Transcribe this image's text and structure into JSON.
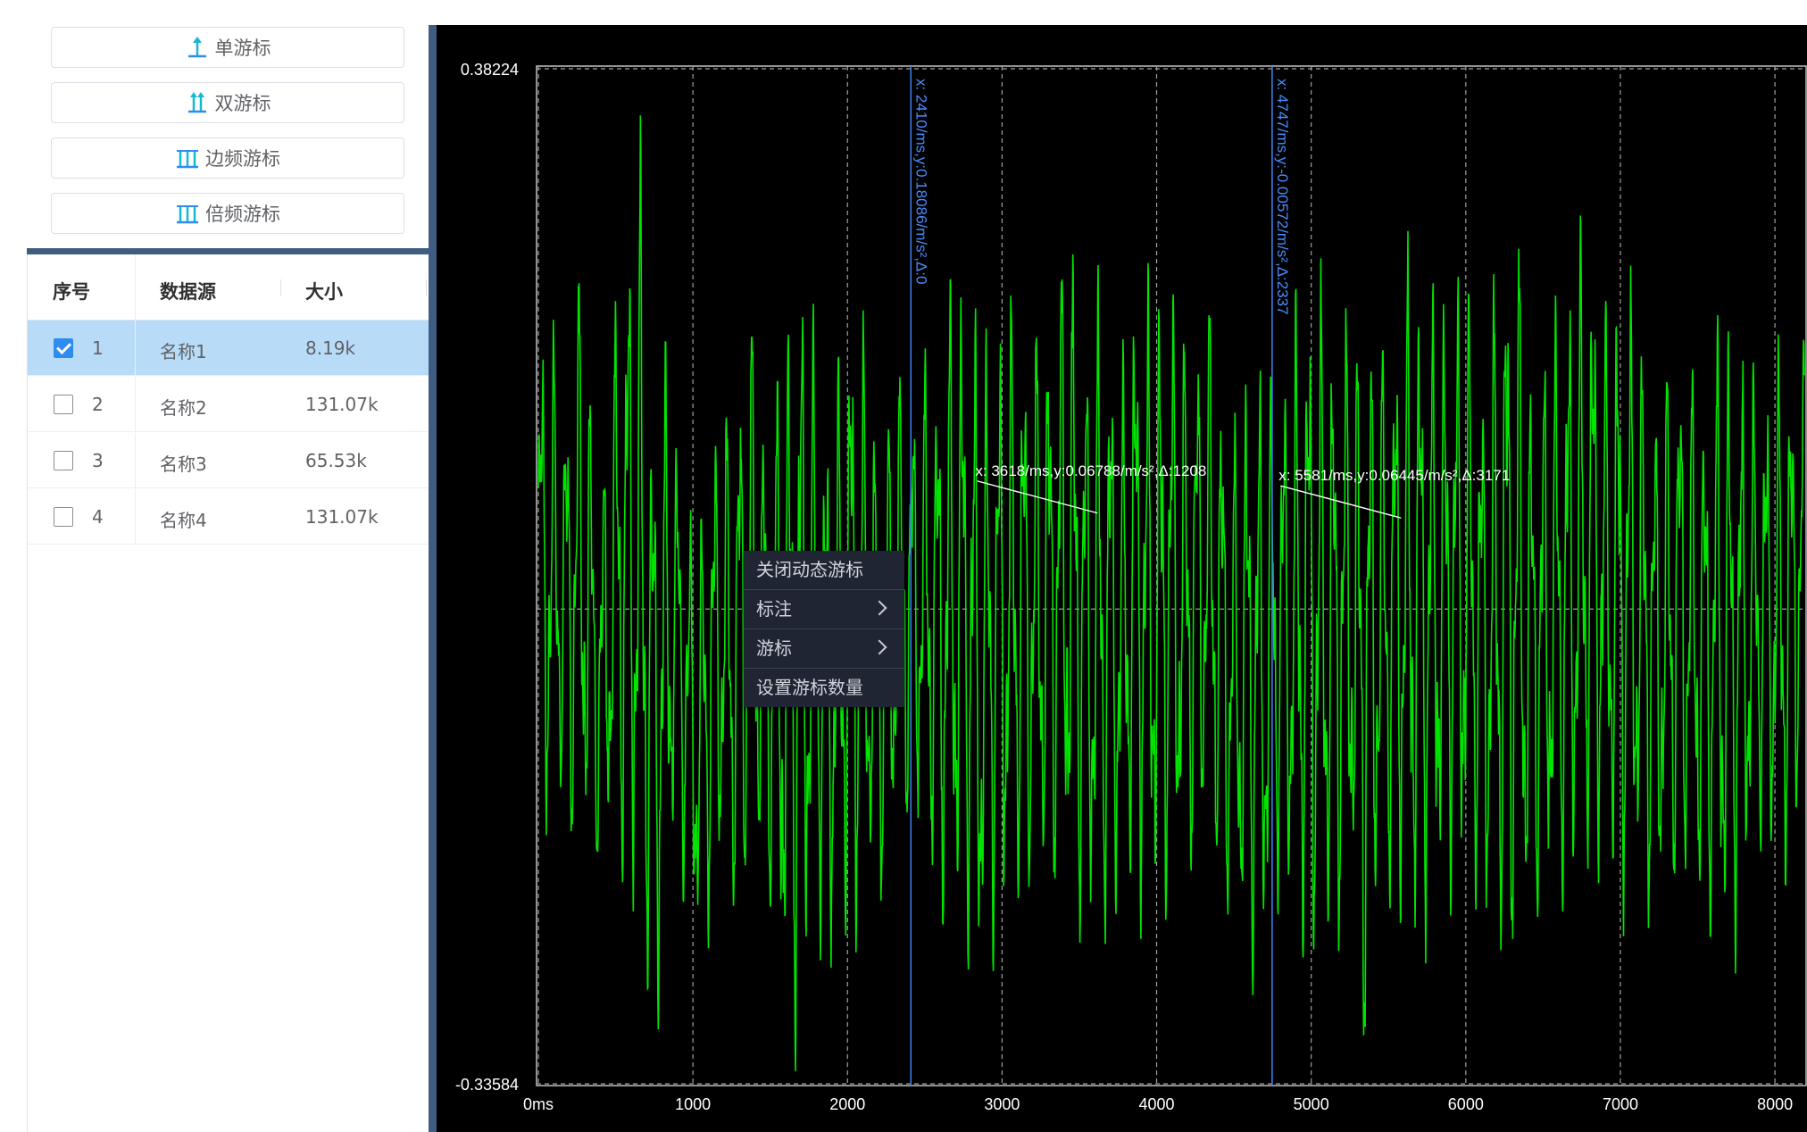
{
  "toolbar": {
    "single_cursor": "单游标",
    "double_cursor": "双游标",
    "sideband_cursor": "边频游标",
    "harmonic_cursor": "倍频游标"
  },
  "table": {
    "headers": [
      "序号",
      "数据源",
      "大小"
    ],
    "rows": [
      {
        "index": "1",
        "source": "名称1",
        "size": "8.19k",
        "checked": true
      },
      {
        "index": "2",
        "source": "名称2",
        "size": "131.07k",
        "checked": false
      },
      {
        "index": "3",
        "source": "名称3",
        "size": "65.53k",
        "checked": false
      },
      {
        "index": "4",
        "source": "名称4",
        "size": "131.07k",
        "checked": false
      }
    ]
  },
  "context_menu": {
    "items": [
      "关闭动态游标",
      "标注",
      "游标",
      "设置游标数量"
    ]
  },
  "colors": {
    "trace": "#00e400",
    "cursor": "#3b7de8",
    "selected_row": "#b8dcf8",
    "panel_bar": "#3e5d80"
  },
  "chart_data": {
    "type": "line",
    "xlim": [
      0,
      8190
    ],
    "ylim": [
      -0.33584,
      0.38224
    ],
    "y_tick_labels": [
      "0.38224",
      "-0.33584"
    ],
    "x_ticks": [
      0,
      1000,
      2000,
      3000,
      4000,
      5000,
      6000,
      7000,
      8000
    ],
    "x_tick_labels": [
      "0ms",
      "1000",
      "2000",
      "3000",
      "4000",
      "5000",
      "6000",
      "7000",
      "8000"
    ],
    "grid": true,
    "cursors": [
      {
        "x": 2410,
        "label": "x: 2410/ms,y:0.18086/m/s²,Δ:0"
      },
      {
        "x": 4747,
        "label": "x: 4747/ms,y:-0.00572/m/s²,Δ:2337"
      }
    ],
    "annotations": [
      {
        "x": 3618,
        "y": 0.06788,
        "label": "x: 3618/ms,y:0.06788/m/s²,Δ:1208"
      },
      {
        "x": 5581,
        "y": 0.06445,
        "label": "x: 5581/ms,y:0.06445/m/s²,Δ:3171"
      }
    ],
    "series": [
      {
        "signal": "vibration",
        "peaks": [
          [
            60,
            0.23
          ],
          [
            170,
            0.17
          ],
          [
            285,
            0.29
          ],
          [
            370,
            0.12
          ],
          [
            420,
            0.12
          ],
          [
            510,
            0.26
          ],
          [
            660,
            0.35
          ],
          [
            740,
            0.17
          ],
          [
            810,
            0.2
          ],
          [
            900,
            0.14
          ],
          [
            1020,
            0.06
          ],
          [
            1180,
            0.19
          ],
          [
            1250,
            0.14
          ],
          [
            1350,
            0.26
          ],
          [
            1480,
            0.14
          ],
          [
            1680,
            0.29
          ],
          [
            1800,
            0.2
          ],
          [
            1880,
            0.15
          ],
          [
            2050,
            0.27
          ],
          [
            2200,
            0.13
          ],
          [
            2300,
            0.2
          ],
          [
            2410,
            0.18
          ],
          [
            2580,
            0.2
          ],
          [
            2690,
            0.28
          ],
          [
            2800,
            0.24
          ],
          [
            2900,
            0.21
          ],
          [
            3060,
            0.24
          ],
          [
            3130,
            0.22
          ],
          [
            3300,
            0.23
          ],
          [
            3420,
            0.31
          ],
          [
            3580,
            0.2
          ],
          [
            3640,
            0.27
          ],
          [
            3760,
            0.17
          ],
          [
            3880,
            0.28
          ],
          [
            3960,
            0.24
          ],
          [
            4070,
            0.27
          ],
          [
            4200,
            0.22
          ],
          [
            4340,
            0.25
          ],
          [
            4480,
            0.14
          ],
          [
            4600,
            0.2
          ],
          [
            4750,
            0.19
          ],
          [
            4870,
            0.21
          ],
          [
            4990,
            0.28
          ],
          [
            5120,
            0.23
          ],
          [
            5230,
            0.24
          ],
          [
            5360,
            0.24
          ],
          [
            5490,
            0.21
          ],
          [
            5620,
            0.27
          ],
          [
            5720,
            0.26
          ],
          [
            5860,
            0.24
          ],
          [
            5990,
            0.27
          ],
          [
            6100,
            0.2
          ],
          [
            6250,
            0.29
          ],
          [
            6300,
            0.35
          ],
          [
            6420,
            0.19
          ],
          [
            6600,
            0.24
          ],
          [
            6800,
            0.3
          ],
          [
            6900,
            0.23
          ],
          [
            7050,
            0.26
          ],
          [
            7220,
            0.18
          ],
          [
            7380,
            0.22
          ],
          [
            7520,
            0.17
          ],
          [
            7650,
            0.24
          ],
          [
            7760,
            0.21
          ],
          [
            7900,
            0.18
          ],
          [
            8150,
            0.21
          ]
        ],
        "troughs": [
          [
            20,
            -0.2
          ],
          [
            130,
            -0.15
          ],
          [
            230,
            -0.2
          ],
          [
            330,
            -0.21
          ],
          [
            500,
            -0.19
          ],
          [
            760,
            -0.34
          ],
          [
            880,
            -0.17
          ],
          [
            1040,
            -0.27
          ],
          [
            1200,
            -0.21
          ],
          [
            1280,
            -0.25
          ],
          [
            1460,
            -0.2
          ],
          [
            1580,
            -0.32
          ],
          [
            1670,
            -0.35
          ],
          [
            1800,
            -0.24
          ],
          [
            1880,
            -0.27
          ],
          [
            2050,
            -0.25
          ],
          [
            2140,
            -0.23
          ],
          [
            2250,
            -0.22
          ],
          [
            2360,
            -0.17
          ],
          [
            2500,
            -0.18
          ],
          [
            2600,
            -0.25
          ],
          [
            2780,
            -0.26
          ],
          [
            2850,
            -0.33
          ],
          [
            2920,
            -0.26
          ],
          [
            3040,
            -0.24
          ],
          [
            3300,
            -0.22
          ],
          [
            3560,
            -0.26
          ],
          [
            3630,
            -0.28
          ],
          [
            3800,
            -0.22
          ],
          [
            4020,
            -0.25
          ],
          [
            4150,
            -0.23
          ],
          [
            4300,
            -0.19
          ],
          [
            4450,
            -0.24
          ],
          [
            4680,
            -0.3
          ],
          [
            4800,
            -0.22
          ],
          [
            4990,
            -0.29
          ],
          [
            5260,
            -0.24
          ],
          [
            5330,
            -0.36
          ],
          [
            5460,
            -0.22
          ],
          [
            5640,
            -0.27
          ],
          [
            5900,
            -0.22
          ],
          [
            6050,
            -0.23
          ],
          [
            6280,
            -0.3
          ],
          [
            6450,
            -0.24
          ],
          [
            6650,
            -0.24
          ],
          [
            6870,
            -0.2
          ],
          [
            6980,
            -0.23
          ],
          [
            7250,
            -0.24
          ],
          [
            7450,
            -0.22
          ],
          [
            7700,
            -0.29
          ],
          [
            7890,
            -0.18
          ],
          [
            8080,
            -0.23
          ],
          [
            8190,
            -0.1
          ]
        ]
      }
    ]
  }
}
